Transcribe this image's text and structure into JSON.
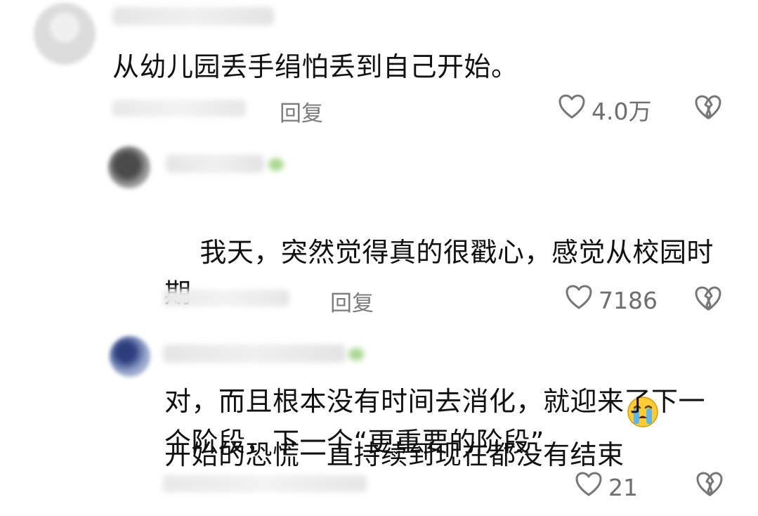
{
  "comments": [
    {
      "text": "从幼儿园丢手绢怕丢到自己开始。",
      "reply_label": "回复",
      "likes": "4.0万"
    },
    {
      "text": "我天，突然觉得真的很戳心，感觉从校园时期\n开始的恐慌一直持续到现在都没有结束",
      "reply_label": "回复",
      "likes": "7186",
      "emoji": "crying-face"
    },
    {
      "text": "对，而且根本没有时间去消化，就迎来了下一\n个阶段，下一个“更重要的阶段”",
      "likes": "21"
    }
  ]
}
